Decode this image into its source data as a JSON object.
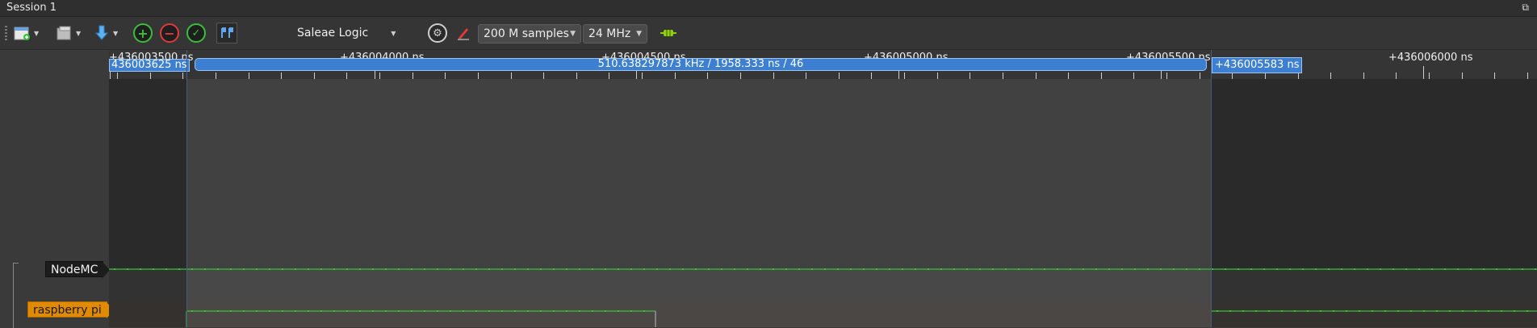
{
  "window": {
    "title": "Session 1",
    "restore_glyph": "⧉"
  },
  "toolbar": {
    "device": "Saleae Logic",
    "sample_count": "200 M samples",
    "sample_rate": "24 MHz",
    "icons": [
      "new-session-icon",
      "open-folder-icon",
      "download-icon",
      "zoom-in-icon",
      "zoom-out-icon",
      "zoom-fit-icon",
      "markers-icon",
      "settings-gear-icon",
      "trigger-pen-icon",
      "start-capture-icon"
    ]
  },
  "timeline": {
    "labels": [
      "+436003500 ns",
      "+436004000 ns",
      "+436004500 ns",
      "+436005000 ns",
      "+436005500 ns",
      "+436006000 ns"
    ],
    "marker_left": "436003625 ns",
    "marker_right": "+436005583 ns",
    "measurement": "510.638297873 kHz / 1958.333 ns / 46"
  },
  "channels": [
    {
      "name": "NodeMC",
      "color": "#1c1c1c"
    },
    {
      "name": "raspberry pi",
      "color": "#e08a00"
    }
  ],
  "colors": {
    "signal_high": "#3bbf3b",
    "signal_low": "#c43a3a",
    "marker": "#3d7fd0"
  }
}
